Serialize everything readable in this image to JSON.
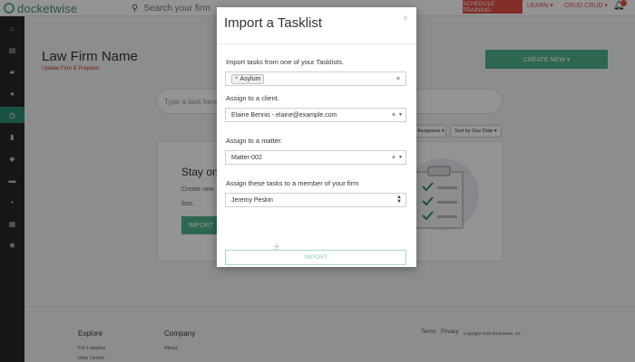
{
  "app": {
    "logo_text": "docketwise"
  },
  "topbar": {
    "search_placeholder": "Search your firm",
    "schedule_training": "SCHEDULE TRAINING",
    "learn_menu": "LEARN ▾",
    "user_menu": "CRUD CRUD ▾",
    "accent_color": "#e04f45"
  },
  "sidebar": {
    "items": [
      {
        "icon": "home-icon",
        "glyph": "⌂"
      },
      {
        "icon": "dashboard-icon",
        "glyph": "▤"
      },
      {
        "icon": "folder-icon",
        "glyph": "▰"
      },
      {
        "icon": "user-icon",
        "glyph": "●"
      },
      {
        "icon": "clock-icon",
        "glyph": "◷",
        "active": true
      },
      {
        "icon": "document-icon",
        "glyph": "▮"
      },
      {
        "icon": "tag-icon",
        "glyph": "◆"
      },
      {
        "icon": "inbox-icon",
        "glyph": "▬"
      },
      {
        "icon": "chat-icon",
        "glyph": "▪"
      },
      {
        "icon": "calendar-icon",
        "glyph": "▦"
      },
      {
        "icon": "settings-icon",
        "glyph": "✱"
      }
    ]
  },
  "page": {
    "title": "Law Firm Name",
    "subtitle": "Update Firm & Preparer",
    "create_new_label": "CREATE NEW ▾",
    "task_placeholder": "Type a task here, ...",
    "filters": {
      "assignees": "Assignees ▾",
      "sort": "Sort by Due Date ▾"
    },
    "card": {
      "title": "Stay on",
      "line1": "Create new",
      "line2": "lists.",
      "button": "IMPORT"
    }
  },
  "footer": {
    "explore_heading": "Explore",
    "explore_links": [
      "For Lawyers",
      "Help Center"
    ],
    "company_heading": "Company",
    "company_links": [
      "About"
    ],
    "terms": "Terms",
    "privacy": "Privacy",
    "copyright": "Copyright 2020 Borderwise, Inc."
  },
  "modal": {
    "title": "Import a Tasklist",
    "close_glyph": "×",
    "tasklist_label": "Import tasks from one of your Tasklists.",
    "tasklist_tag": "Asylum",
    "client_label": "Assign to a client.",
    "client_value": "Elaine Bennis - elaine@example.com",
    "matter_label": "Assign to a matter.",
    "matter_value": "Matter-002",
    "member_label": "Assign these tasks to a member of your firm",
    "member_value": "Jeremy Peskin",
    "import_button": "IMPORT",
    "primary_color": "#50b188"
  }
}
